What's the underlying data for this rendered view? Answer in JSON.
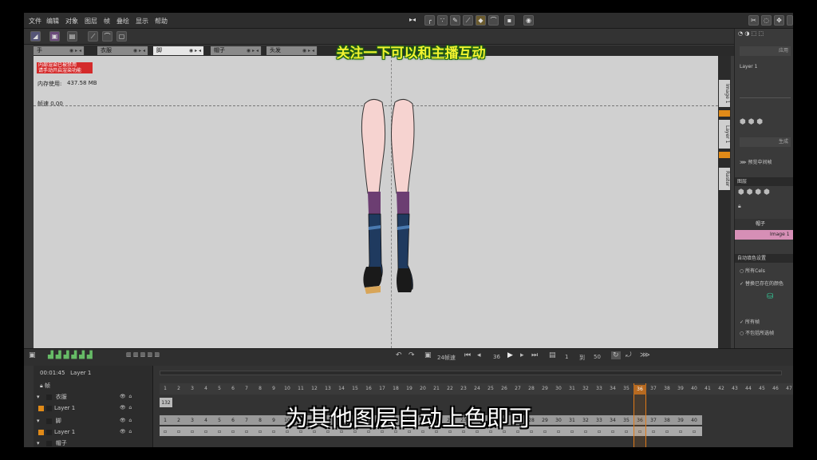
{
  "menu": [
    "文件",
    "编辑",
    "对象",
    "图层",
    "帧",
    "叠绘",
    "显示",
    "帮助"
  ],
  "tabs": [
    {
      "label": "手"
    },
    {
      "label": "衣服"
    },
    {
      "label": "脚"
    },
    {
      "label": "帽子"
    },
    {
      "label": "头发"
    }
  ],
  "canvas": {
    "red_label_line1": "内部渲染已被禁用",
    "red_label_line2": "请手动开启渲染功能",
    "memory_label": "内存使用:",
    "memory_value": "437.58 MB",
    "fps_label": "帧速 0.00"
  },
  "right_panel": {
    "apply_label": "应用",
    "layer_name": "Layer 1",
    "generate_label": "生成",
    "preview_label": "预览中间帧",
    "layers_head": "图层",
    "layer_group": "帽子",
    "layer_image": "Image 1",
    "autofill_head": "自动填色设置",
    "all_cels": "所有Cels",
    "replace_existing": "替换已存在的颜色",
    "all_frames": "所有帧",
    "exclude_transparent": "不包括所选帧"
  },
  "right_strip_tabs": [
    "Image 1",
    "Layer 1",
    "Raster"
  ],
  "playbar": {
    "fps": "24帧速",
    "frame_a": "36",
    "frame_b": "1",
    "frame_c": "到",
    "frame_d": "50"
  },
  "timeline": {
    "time": "00:01:45",
    "layer_label": "Layer 1",
    "all_label": "帧",
    "layers": [
      {
        "group": "衣服",
        "child": "Layer 1"
      },
      {
        "group": "脚",
        "child": "Layer 1"
      },
      {
        "group": "帽子",
        "child": ""
      }
    ],
    "current_frame": "36",
    "cell_label": "132"
  },
  "overlay": {
    "follow_text": "关注一下可以和主播互动",
    "caption_text": "为其他图层自动上色即可"
  },
  "colors": {
    "playhead": "#e07a18",
    "follow_text": "#f2f230",
    "red_label": "#d42a2a",
    "layer_highlight": "#d68fb6"
  }
}
